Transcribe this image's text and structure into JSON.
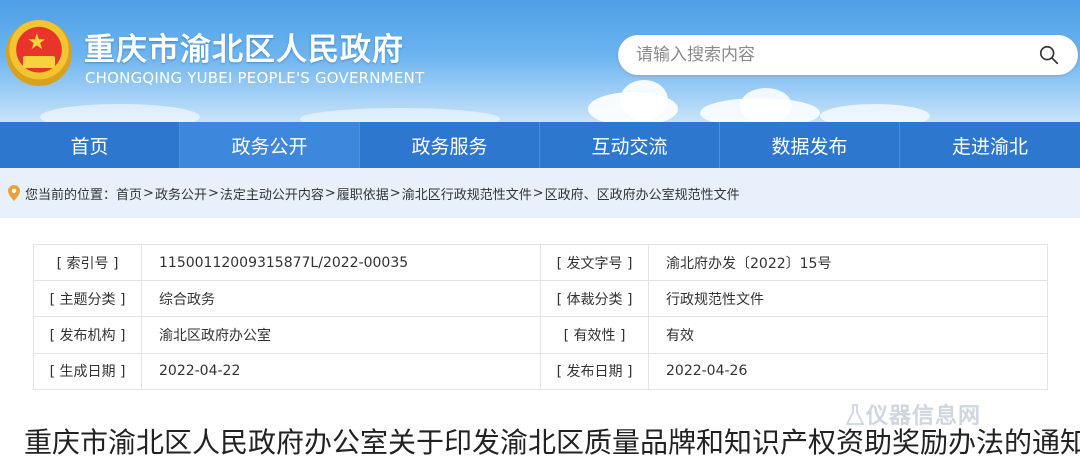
{
  "header": {
    "site_title": "重庆市渝北区人民政府",
    "site_subtitle": "CHONGQING YUBEI PEOPLE'S GOVERNMENT",
    "search_placeholder": "请输入搜索内容",
    "accent_color": "#2d77cf"
  },
  "nav": {
    "items": [
      {
        "label": "首页"
      },
      {
        "label": "政务公开"
      },
      {
        "label": "政务服务"
      },
      {
        "label": "互动交流"
      },
      {
        "label": "数据发布"
      },
      {
        "label": "走进渝北"
      }
    ]
  },
  "breadcrumb": {
    "prefix": "您当前的位置：",
    "items": [
      "首页",
      "政务公开",
      "法定主动公开内容",
      "履职依据",
      "渝北区行政规范性文件",
      "区政府、区政府办公室规范性文件"
    ],
    "separator": ">"
  },
  "meta": {
    "rows": [
      {
        "label1": "[ 索引号 ]",
        "value1": "11500112009315877L/2022-00035",
        "label2": "[ 发文字号 ]",
        "value2": "渝北府办发〔2022〕15号"
      },
      {
        "label1": "[ 主题分类 ]",
        "value1": "综合政务",
        "label2": "[ 体裁分类 ]",
        "value2": "行政规范性文件"
      },
      {
        "label1": "[ 发布机构 ]",
        "value1": "渝北区政府办公室",
        "label2": "[ 有效性 ]",
        "value2": "有效"
      },
      {
        "label1": "[ 生成日期 ]",
        "value1": "2022-04-22",
        "label2": "[ 发布日期 ]",
        "value2": "2022-04-26"
      }
    ]
  },
  "document": {
    "title": "重庆市渝北区人民政府办公室关于印发渝北区质量品牌和知识产权资助奖励办法的通知"
  },
  "watermark": {
    "text": "仪器信息网"
  }
}
